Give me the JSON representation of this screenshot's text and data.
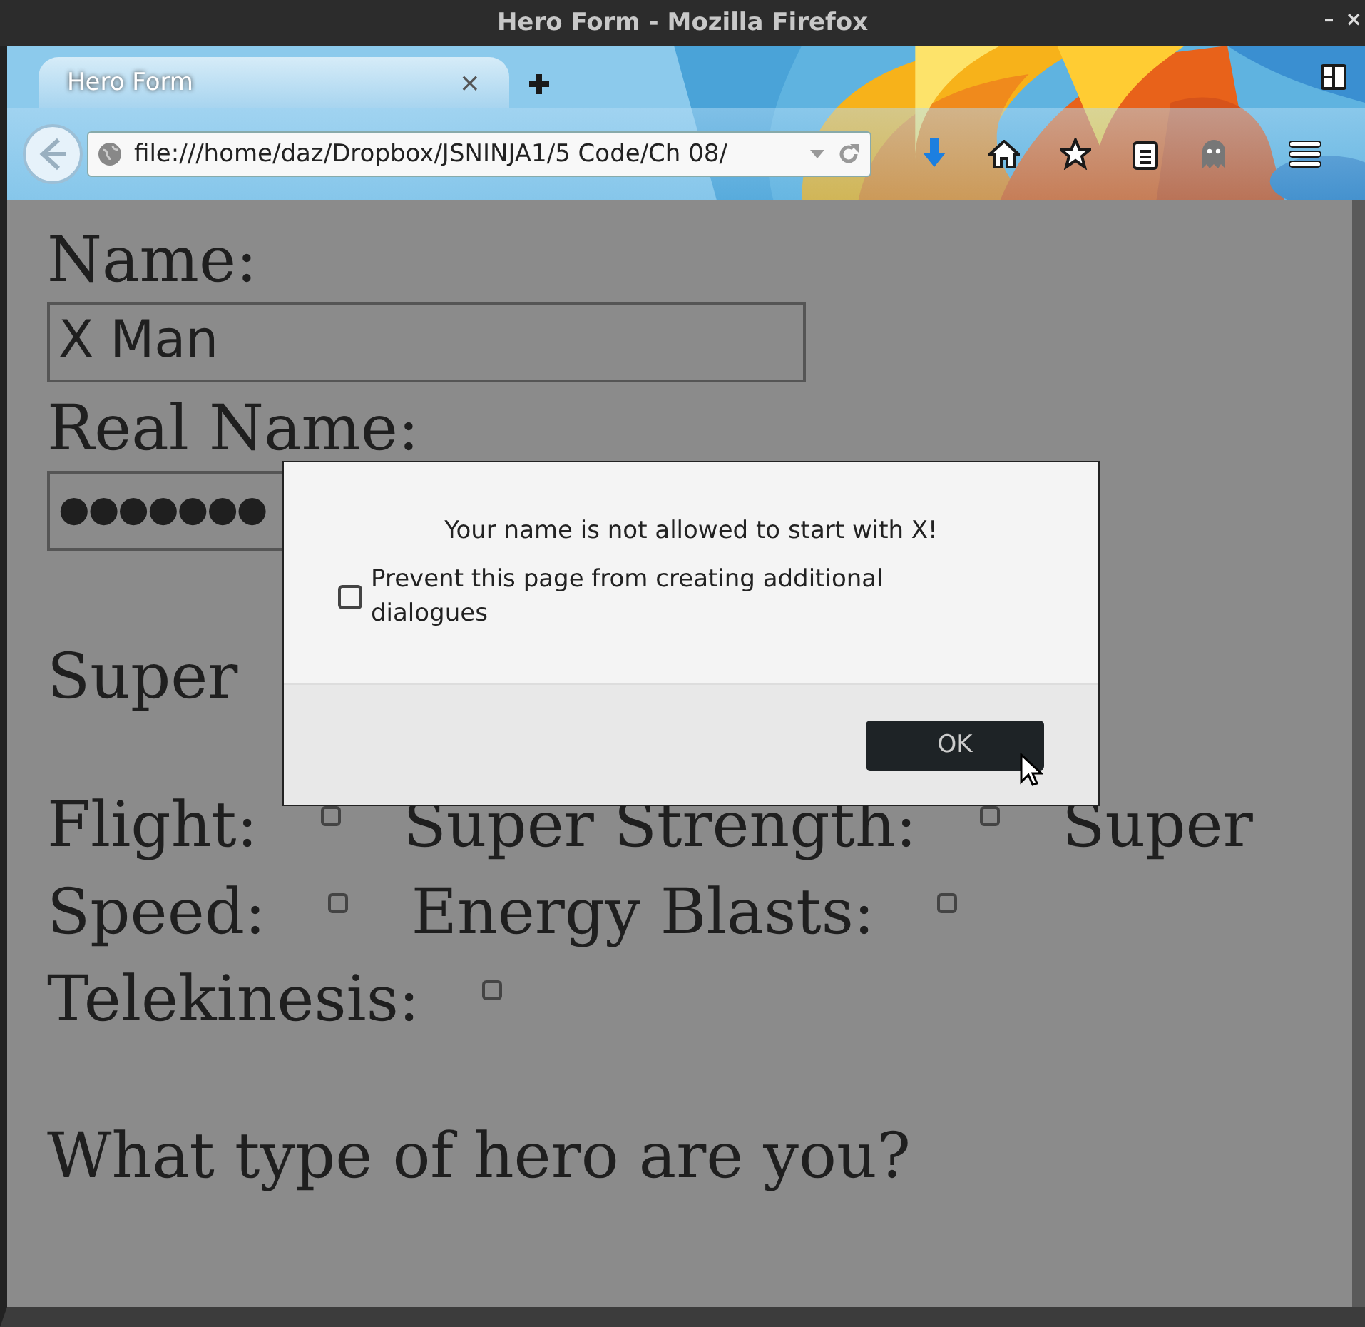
{
  "window": {
    "title": "Hero Form - Mozilla Firefox",
    "controls": [
      "–",
      "×"
    ]
  },
  "tabs": [
    {
      "label": "Hero Form",
      "selected": true,
      "close": "×"
    }
  ],
  "address_bar": {
    "value": "file:///home/daz/Dropbox/JSNINJA1/5 Code/Ch 08/"
  },
  "form": {
    "name_label": "Name:",
    "name_value": "X Man",
    "real_name_label": "Real Name:",
    "real_name_value": "●●●●●●●",
    "section_heading": "Super",
    "powers": [
      {
        "label_lines": [
          "Flight:"
        ],
        "checked": false
      },
      {
        "label_lines": [
          "Super Strength:"
        ],
        "checked": false
      },
      {
        "label_lines": [
          "Super",
          "Speed:"
        ],
        "checked": false
      },
      {
        "label_lines": [
          "Energy Blasts:"
        ],
        "checked": false
      },
      {
        "label_lines": [
          "Telekinesis:"
        ],
        "checked": false
      }
    ],
    "question": "What type of hero are you?"
  },
  "dialog": {
    "message": "Your name is not allowed to start with X!",
    "checkbox": {
      "label": "Prevent this page from creating additional dialogues",
      "checked": false
    },
    "button": "OK"
  }
}
